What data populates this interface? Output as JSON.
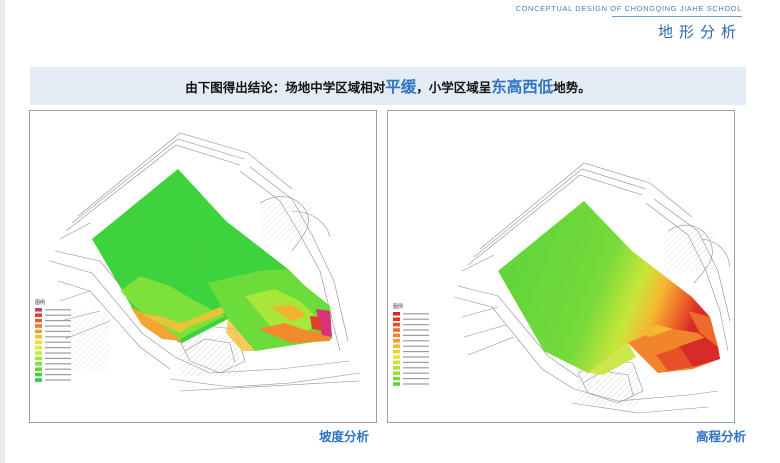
{
  "header": {
    "subtitle": "CONCEPTUAL  DESIGN  OF CHONGQING  JIAHE SCHOOL",
    "title": "地形分析"
  },
  "banner": {
    "part1": "由下图得出结论：场地中学区域相对",
    "highlight1": "平缓",
    "part2": "，小学区域呈",
    "highlight2": "东高西低",
    "part3": "地势。"
  },
  "panels": {
    "slope": {
      "caption": "坡度分析",
      "legend_title": "图例",
      "legend_colors": [
        "#d6337a",
        "#e0412f",
        "#e85c2a",
        "#ef7a2a",
        "#f59a2c",
        "#f7bd34",
        "#f4dc3a",
        "#e2ec3d",
        "#c3ec3a",
        "#a2e83a",
        "#7fe23a",
        "#5ed93a",
        "#44d33c",
        "#33cc3e"
      ]
    },
    "elevation": {
      "caption": "高程分析",
      "legend_title": "图例",
      "legend_colors": [
        "#d92a2a",
        "#e23a2a",
        "#e8502a",
        "#ee6a2a",
        "#f2852c",
        "#f59f2e",
        "#f5b832",
        "#efcf36",
        "#e2e23a",
        "#c8e63a",
        "#aee43a",
        "#92e03a",
        "#76da3a",
        "#5ad33b"
      ]
    }
  }
}
